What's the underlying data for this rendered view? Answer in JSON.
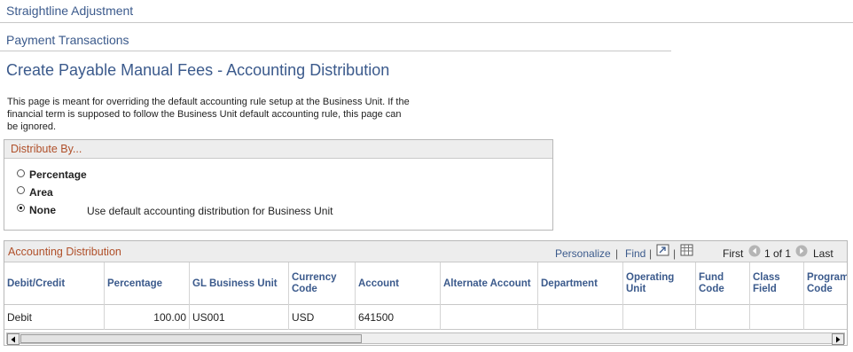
{
  "sections": {
    "straightline": "Straightline Adjustment",
    "payment": "Payment Transactions"
  },
  "page_title": "Create Payable Manual Fees - Accounting Distribution",
  "description": [
    "This page is meant for overriding the default accounting rule setup at the Business Unit. If the",
    "financial term is supposed to follow the Business Unit default accounting rule, this page can",
    "be ignored."
  ],
  "distribute_by": {
    "title": "Distribute By...",
    "options": [
      {
        "label": "Percentage",
        "selected": false
      },
      {
        "label": "Area",
        "selected": false
      },
      {
        "label": "None",
        "selected": true
      }
    ],
    "none_note": "Use default accounting distribution for Business Unit"
  },
  "grid": {
    "title": "Accounting Distribution",
    "personalize": "Personalize",
    "find": "Find",
    "separator": "|",
    "first": "First",
    "range": "1 of 1",
    "last": "Last",
    "columns": [
      "Debit/Credit",
      "Percentage",
      "GL Business Unit",
      "Currency Code",
      "Account",
      "Alternate Account",
      "Department",
      "Operating Unit",
      "Fund Code",
      "Class Field",
      "Program Code"
    ],
    "rows": [
      [
        "Debit",
        "100.00",
        "US001",
        "USD",
        "641500",
        "",
        "",
        "",
        "",
        "",
        ""
      ]
    ]
  }
}
